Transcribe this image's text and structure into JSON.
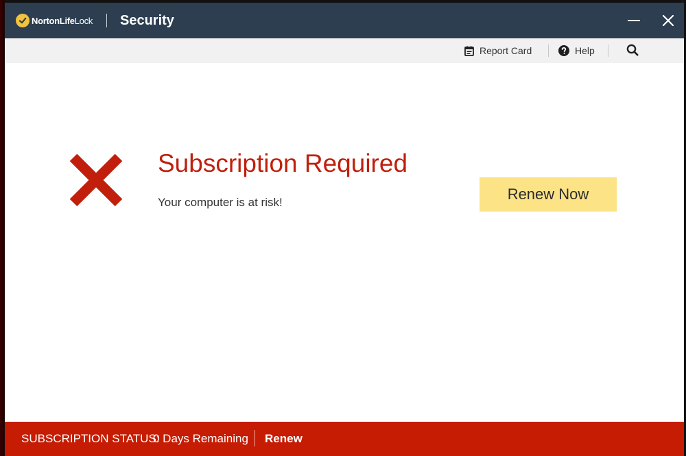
{
  "window": {
    "brand": {
      "strong": "NortonLife",
      "light": "Lock"
    },
    "title": "Security"
  },
  "toolbar": {
    "report_card": {
      "label": "Report Card",
      "icon": "report-card-icon"
    },
    "help": {
      "label": "Help",
      "icon": "help-icon"
    },
    "search": {
      "icon": "search-icon"
    }
  },
  "status": {
    "icon": "red-x-icon",
    "headline": "Subscription Required",
    "message": "Your computer is at risk!",
    "cta_label": "Renew Now"
  },
  "footer": {
    "status_label": "SUBSCRIPTION STATUS:",
    "status_value": "0 Days Remaining",
    "renew_label": "Renew"
  },
  "colors": {
    "titlebar": "#2d3e50",
    "accent_red": "#c11f0c",
    "statusbar_red": "#c51c03",
    "cta_yellow": "#fce386",
    "brand_yellow": "#f3c33a"
  }
}
